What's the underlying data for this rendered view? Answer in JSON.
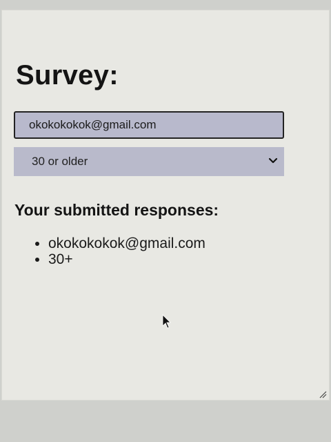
{
  "survey": {
    "title": "Survey:",
    "email_value": "okokokokok@gmail.com",
    "age_selected": "30 or older"
  },
  "responses": {
    "heading": "Your submitted responses:",
    "items": [
      "okokokokok@gmail.com",
      "30+"
    ]
  },
  "colors": {
    "field_background": "#b8b9cc",
    "page_background": "#e8e8e3"
  },
  "icons": {
    "select_arrow": "chevron-down-icon",
    "pointer": "mouse-cursor-icon",
    "resize": "resize-handle-icon"
  }
}
